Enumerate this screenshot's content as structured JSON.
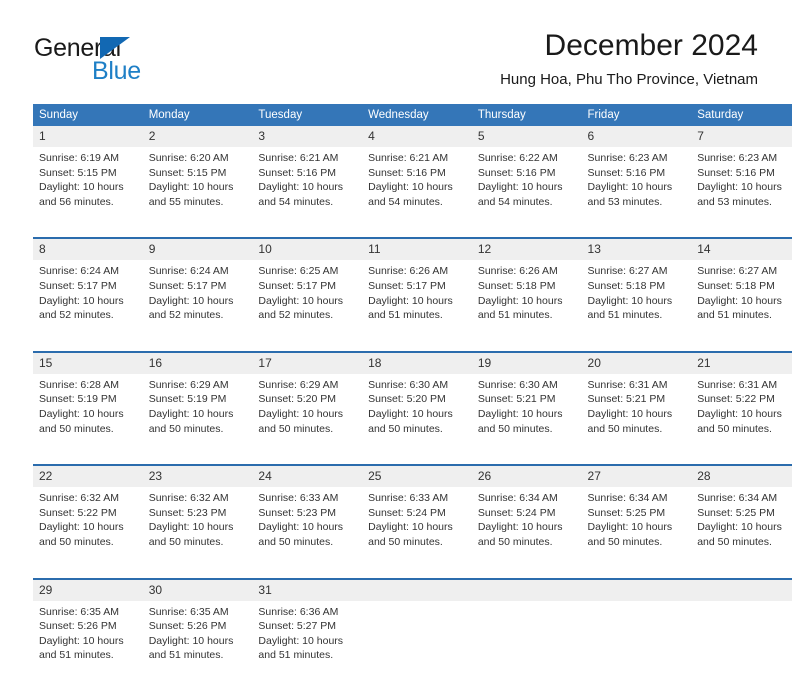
{
  "brand": {
    "name_top": "General",
    "name_bottom": "Blue",
    "accent_color": "#1e7fc6",
    "triangle_color": "#1268b3"
  },
  "header": {
    "title": "December 2024",
    "subtitle": "Hung Hoa, Phu Tho Province, Vietnam"
  },
  "calendar": {
    "header_bg": "#3476b8",
    "daynum_bg": "#efefef",
    "separator_color": "#2b6cad",
    "weekday_headers": [
      "Sunday",
      "Monday",
      "Tuesday",
      "Wednesday",
      "Thursday",
      "Friday",
      "Saturday"
    ],
    "weeks": [
      [
        {
          "day": "1",
          "sunrise": "Sunrise: 6:19 AM",
          "sunset": "Sunset: 5:15 PM",
          "daylight_line1": "Daylight: 10 hours",
          "daylight_line2": "and 56 minutes."
        },
        {
          "day": "2",
          "sunrise": "Sunrise: 6:20 AM",
          "sunset": "Sunset: 5:15 PM",
          "daylight_line1": "Daylight: 10 hours",
          "daylight_line2": "and 55 minutes."
        },
        {
          "day": "3",
          "sunrise": "Sunrise: 6:21 AM",
          "sunset": "Sunset: 5:16 PM",
          "daylight_line1": "Daylight: 10 hours",
          "daylight_line2": "and 54 minutes."
        },
        {
          "day": "4",
          "sunrise": "Sunrise: 6:21 AM",
          "sunset": "Sunset: 5:16 PM",
          "daylight_line1": "Daylight: 10 hours",
          "daylight_line2": "and 54 minutes."
        },
        {
          "day": "5",
          "sunrise": "Sunrise: 6:22 AM",
          "sunset": "Sunset: 5:16 PM",
          "daylight_line1": "Daylight: 10 hours",
          "daylight_line2": "and 54 minutes."
        },
        {
          "day": "6",
          "sunrise": "Sunrise: 6:23 AM",
          "sunset": "Sunset: 5:16 PM",
          "daylight_line1": "Daylight: 10 hours",
          "daylight_line2": "and 53 minutes."
        },
        {
          "day": "7",
          "sunrise": "Sunrise: 6:23 AM",
          "sunset": "Sunset: 5:16 PM",
          "daylight_line1": "Daylight: 10 hours",
          "daylight_line2": "and 53 minutes."
        }
      ],
      [
        {
          "day": "8",
          "sunrise": "Sunrise: 6:24 AM",
          "sunset": "Sunset: 5:17 PM",
          "daylight_line1": "Daylight: 10 hours",
          "daylight_line2": "and 52 minutes."
        },
        {
          "day": "9",
          "sunrise": "Sunrise: 6:24 AM",
          "sunset": "Sunset: 5:17 PM",
          "daylight_line1": "Daylight: 10 hours",
          "daylight_line2": "and 52 minutes."
        },
        {
          "day": "10",
          "sunrise": "Sunrise: 6:25 AM",
          "sunset": "Sunset: 5:17 PM",
          "daylight_line1": "Daylight: 10 hours",
          "daylight_line2": "and 52 minutes."
        },
        {
          "day": "11",
          "sunrise": "Sunrise: 6:26 AM",
          "sunset": "Sunset: 5:17 PM",
          "daylight_line1": "Daylight: 10 hours",
          "daylight_line2": "and 51 minutes."
        },
        {
          "day": "12",
          "sunrise": "Sunrise: 6:26 AM",
          "sunset": "Sunset: 5:18 PM",
          "daylight_line1": "Daylight: 10 hours",
          "daylight_line2": "and 51 minutes."
        },
        {
          "day": "13",
          "sunrise": "Sunrise: 6:27 AM",
          "sunset": "Sunset: 5:18 PM",
          "daylight_line1": "Daylight: 10 hours",
          "daylight_line2": "and 51 minutes."
        },
        {
          "day": "14",
          "sunrise": "Sunrise: 6:27 AM",
          "sunset": "Sunset: 5:18 PM",
          "daylight_line1": "Daylight: 10 hours",
          "daylight_line2": "and 51 minutes."
        }
      ],
      [
        {
          "day": "15",
          "sunrise": "Sunrise: 6:28 AM",
          "sunset": "Sunset: 5:19 PM",
          "daylight_line1": "Daylight: 10 hours",
          "daylight_line2": "and 50 minutes."
        },
        {
          "day": "16",
          "sunrise": "Sunrise: 6:29 AM",
          "sunset": "Sunset: 5:19 PM",
          "daylight_line1": "Daylight: 10 hours",
          "daylight_line2": "and 50 minutes."
        },
        {
          "day": "17",
          "sunrise": "Sunrise: 6:29 AM",
          "sunset": "Sunset: 5:20 PM",
          "daylight_line1": "Daylight: 10 hours",
          "daylight_line2": "and 50 minutes."
        },
        {
          "day": "18",
          "sunrise": "Sunrise: 6:30 AM",
          "sunset": "Sunset: 5:20 PM",
          "daylight_line1": "Daylight: 10 hours",
          "daylight_line2": "and 50 minutes."
        },
        {
          "day": "19",
          "sunrise": "Sunrise: 6:30 AM",
          "sunset": "Sunset: 5:21 PM",
          "daylight_line1": "Daylight: 10 hours",
          "daylight_line2": "and 50 minutes."
        },
        {
          "day": "20",
          "sunrise": "Sunrise: 6:31 AM",
          "sunset": "Sunset: 5:21 PM",
          "daylight_line1": "Daylight: 10 hours",
          "daylight_line2": "and 50 minutes."
        },
        {
          "day": "21",
          "sunrise": "Sunrise: 6:31 AM",
          "sunset": "Sunset: 5:22 PM",
          "daylight_line1": "Daylight: 10 hours",
          "daylight_line2": "and 50 minutes."
        }
      ],
      [
        {
          "day": "22",
          "sunrise": "Sunrise: 6:32 AM",
          "sunset": "Sunset: 5:22 PM",
          "daylight_line1": "Daylight: 10 hours",
          "daylight_line2": "and 50 minutes."
        },
        {
          "day": "23",
          "sunrise": "Sunrise: 6:32 AM",
          "sunset": "Sunset: 5:23 PM",
          "daylight_line1": "Daylight: 10 hours",
          "daylight_line2": "and 50 minutes."
        },
        {
          "day": "24",
          "sunrise": "Sunrise: 6:33 AM",
          "sunset": "Sunset: 5:23 PM",
          "daylight_line1": "Daylight: 10 hours",
          "daylight_line2": "and 50 minutes."
        },
        {
          "day": "25",
          "sunrise": "Sunrise: 6:33 AM",
          "sunset": "Sunset: 5:24 PM",
          "daylight_line1": "Daylight: 10 hours",
          "daylight_line2": "and 50 minutes."
        },
        {
          "day": "26",
          "sunrise": "Sunrise: 6:34 AM",
          "sunset": "Sunset: 5:24 PM",
          "daylight_line1": "Daylight: 10 hours",
          "daylight_line2": "and 50 minutes."
        },
        {
          "day": "27",
          "sunrise": "Sunrise: 6:34 AM",
          "sunset": "Sunset: 5:25 PM",
          "daylight_line1": "Daylight: 10 hours",
          "daylight_line2": "and 50 minutes."
        },
        {
          "day": "28",
          "sunrise": "Sunrise: 6:34 AM",
          "sunset": "Sunset: 5:25 PM",
          "daylight_line1": "Daylight: 10 hours",
          "daylight_line2": "and 50 minutes."
        }
      ],
      [
        {
          "day": "29",
          "sunrise": "Sunrise: 6:35 AM",
          "sunset": "Sunset: 5:26 PM",
          "daylight_line1": "Daylight: 10 hours",
          "daylight_line2": "and 51 minutes."
        },
        {
          "day": "30",
          "sunrise": "Sunrise: 6:35 AM",
          "sunset": "Sunset: 5:26 PM",
          "daylight_line1": "Daylight: 10 hours",
          "daylight_line2": "and 51 minutes."
        },
        {
          "day": "31",
          "sunrise": "Sunrise: 6:36 AM",
          "sunset": "Sunset: 5:27 PM",
          "daylight_line1": "Daylight: 10 hours",
          "daylight_line2": "and 51 minutes."
        },
        {
          "day": "",
          "sunrise": "",
          "sunset": "",
          "daylight_line1": "",
          "daylight_line2": ""
        },
        {
          "day": "",
          "sunrise": "",
          "sunset": "",
          "daylight_line1": "",
          "daylight_line2": ""
        },
        {
          "day": "",
          "sunrise": "",
          "sunset": "",
          "daylight_line1": "",
          "daylight_line2": ""
        },
        {
          "day": "",
          "sunrise": "",
          "sunset": "",
          "daylight_line1": "",
          "daylight_line2": ""
        }
      ]
    ]
  }
}
